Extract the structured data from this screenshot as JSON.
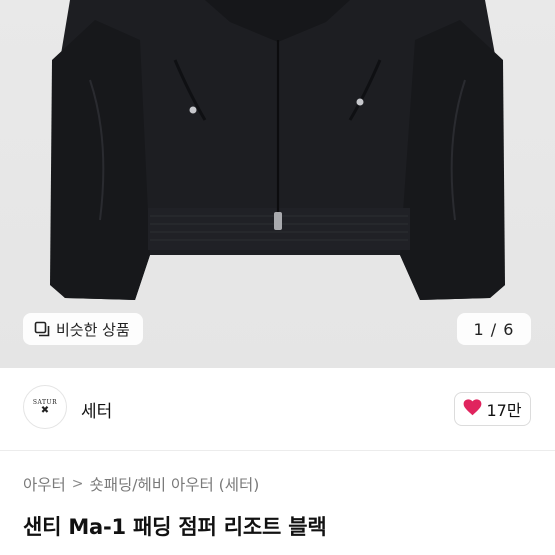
{
  "photo": {
    "similar_label": "비슷한 상품",
    "counter": "1 / 6"
  },
  "shop": {
    "logo_text": "SATUR",
    "logo_mark": "✖",
    "name": "세터",
    "likes": "17만"
  },
  "breadcrumb": {
    "items": [
      "아우터",
      "숏패딩/헤비 아우터 (세터)"
    ],
    "separator": ">"
  },
  "product": {
    "title": "샌티 Ma-1 패딩 점퍼 리조트 블랙"
  },
  "colors": {
    "like_heart": "#e0245e"
  }
}
